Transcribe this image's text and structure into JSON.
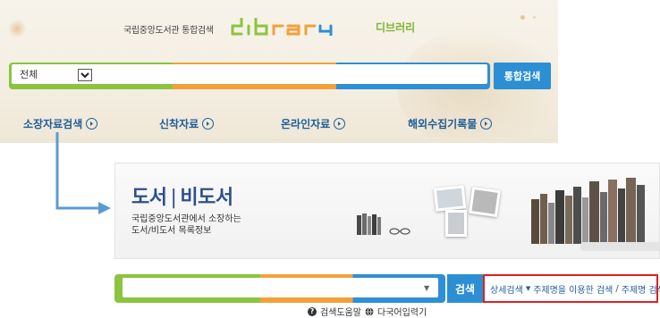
{
  "header": {
    "subtitle": "국립중앙도서관 통합검색",
    "logo_text": "dibrary",
    "logo_korean": "디브러리",
    "scope": {
      "selected": "전체"
    },
    "unified_search_label": "통합검색"
  },
  "nav": {
    "items": [
      {
        "label": "소장자료검색",
        "icon": "circle-arrow-right-icon"
      },
      {
        "label": "신착자료",
        "icon": "circle-arrow-right-icon"
      },
      {
        "label": "온라인자료",
        "icon": "circle-arrow-right-icon"
      },
      {
        "label": "해외수집기록물",
        "icon": "circle-arrow-right-icon"
      }
    ]
  },
  "category": {
    "title_left": "도서",
    "title_right": "비도서",
    "description_line1": "국립중앙도서관에서 소장하는",
    "description_line2": "도서/비도서 목록정보"
  },
  "search": {
    "button_label": "검색",
    "advanced": {
      "detail": "상세검색",
      "subject_heading": "주제명을 이용한 검색",
      "separator": "/",
      "subject": "주제명 검색"
    }
  },
  "help": {
    "guide": "검색도움말",
    "multilingual": "다국어입력기"
  },
  "colors": {
    "accent_green": "#8bc43f",
    "accent_orange": "#f4a03a",
    "accent_blue": "#2e8fd6",
    "highlight_red": "#e02020",
    "title_blue": "#2c4f8a"
  }
}
